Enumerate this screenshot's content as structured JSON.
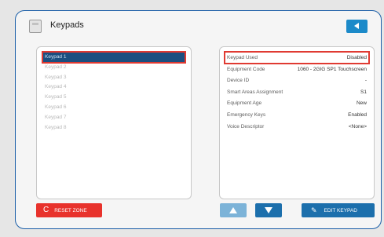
{
  "header": {
    "title": "Keypads",
    "icon": "keypad-icon",
    "back_icon": "back-arrow-icon"
  },
  "keypad_list": [
    {
      "label": "Keypad 1",
      "selected": true
    },
    {
      "label": "Keypad 2",
      "selected": false
    },
    {
      "label": "Keypad 3",
      "selected": false
    },
    {
      "label": "Keypad 4",
      "selected": false
    },
    {
      "label": "Keypad 5",
      "selected": false
    },
    {
      "label": "Keypad 6",
      "selected": false
    },
    {
      "label": "Keypad 7",
      "selected": false
    },
    {
      "label": "Keypad 8",
      "selected": false
    }
  ],
  "properties": [
    {
      "label": "Keypad Used",
      "value": "Disabled",
      "highlight": true
    },
    {
      "label": "Equipment Code",
      "value": "1060 - 2GIG SP1 Touchscreen",
      "highlight": false
    },
    {
      "label": "Device ID",
      "value": "-",
      "highlight": false
    },
    {
      "label": "Smart Areas Assignment",
      "value": "S1",
      "highlight": false
    },
    {
      "label": "Equipment Age",
      "value": "New",
      "highlight": false
    },
    {
      "label": "Emergency Keys",
      "value": "Enabled",
      "highlight": false
    },
    {
      "label": "Voice Descriptor",
      "value": "<None>",
      "highlight": false
    }
  ],
  "buttons": {
    "reset_zone": "RESET ZONE",
    "edit_keypad": "EDIT KEYPAD"
  },
  "colors": {
    "accent": "#1c8ac9",
    "primary": "#1c6fac",
    "danger": "#e8322c",
    "selection": "#1b4f80",
    "frame": "#1a5ea8"
  }
}
